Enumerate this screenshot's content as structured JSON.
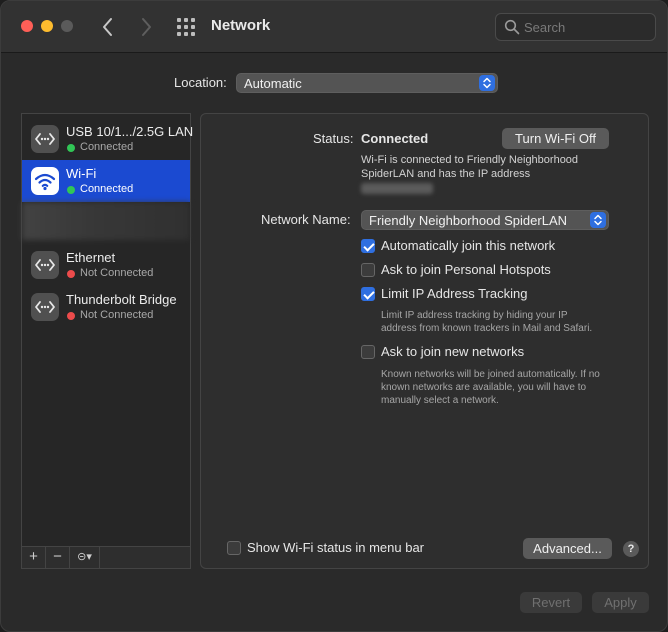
{
  "window": {
    "title": "Network",
    "search_placeholder": "Search"
  },
  "location": {
    "label": "Location:",
    "value": "Automatic"
  },
  "services": [
    {
      "name": "USB 10/1.../2.5G LAN",
      "status": "Connected",
      "status_color": "#31c656"
    },
    {
      "name": "Wi-Fi",
      "status": "Connected",
      "status_color": "#31c656"
    },
    {
      "name": "Ethernet",
      "status": "Not Connected",
      "status_color": "#ec4b4b"
    },
    {
      "name": "Thunderbolt Bridge",
      "status": "Not Connected",
      "status_color": "#ec4b4b"
    }
  ],
  "sidebar_toolbar": {
    "add": "+",
    "remove": "−",
    "action": "⊝▾"
  },
  "detail": {
    "status_label": "Status:",
    "status_value": "Connected",
    "turn_off_button": "Turn Wi-Fi Off",
    "status_desc_1": "Wi-Fi is connected to Friendly Neighborhood",
    "status_desc_2": "SpiderLAN and has the IP address",
    "network_name_label": "Network Name:",
    "network_name_value": "Friendly Neighborhood SpiderLAN",
    "auto_join": "Automatically join this network",
    "ask_hotspots": "Ask to join Personal Hotspots",
    "limit_ip": "Limit IP Address Tracking",
    "limit_ip_desc_1": "Limit IP address tracking by hiding your IP",
    "limit_ip_desc_2": "address from known trackers in Mail and Safari.",
    "ask_new": "Ask to join new networks",
    "ask_new_desc_1": "Known networks will be joined automatically. If no",
    "ask_new_desc_2": "known networks are available, you will have to",
    "ask_new_desc_3": "manually select a network.",
    "show_status": "Show Wi-Fi status in menu bar",
    "advanced_button": "Advanced...",
    "help": "?"
  },
  "footer": {
    "revert": "Revert",
    "apply": "Apply"
  },
  "colors": {
    "accent": "#2f6fe0",
    "selection": "#1b4ad1"
  }
}
